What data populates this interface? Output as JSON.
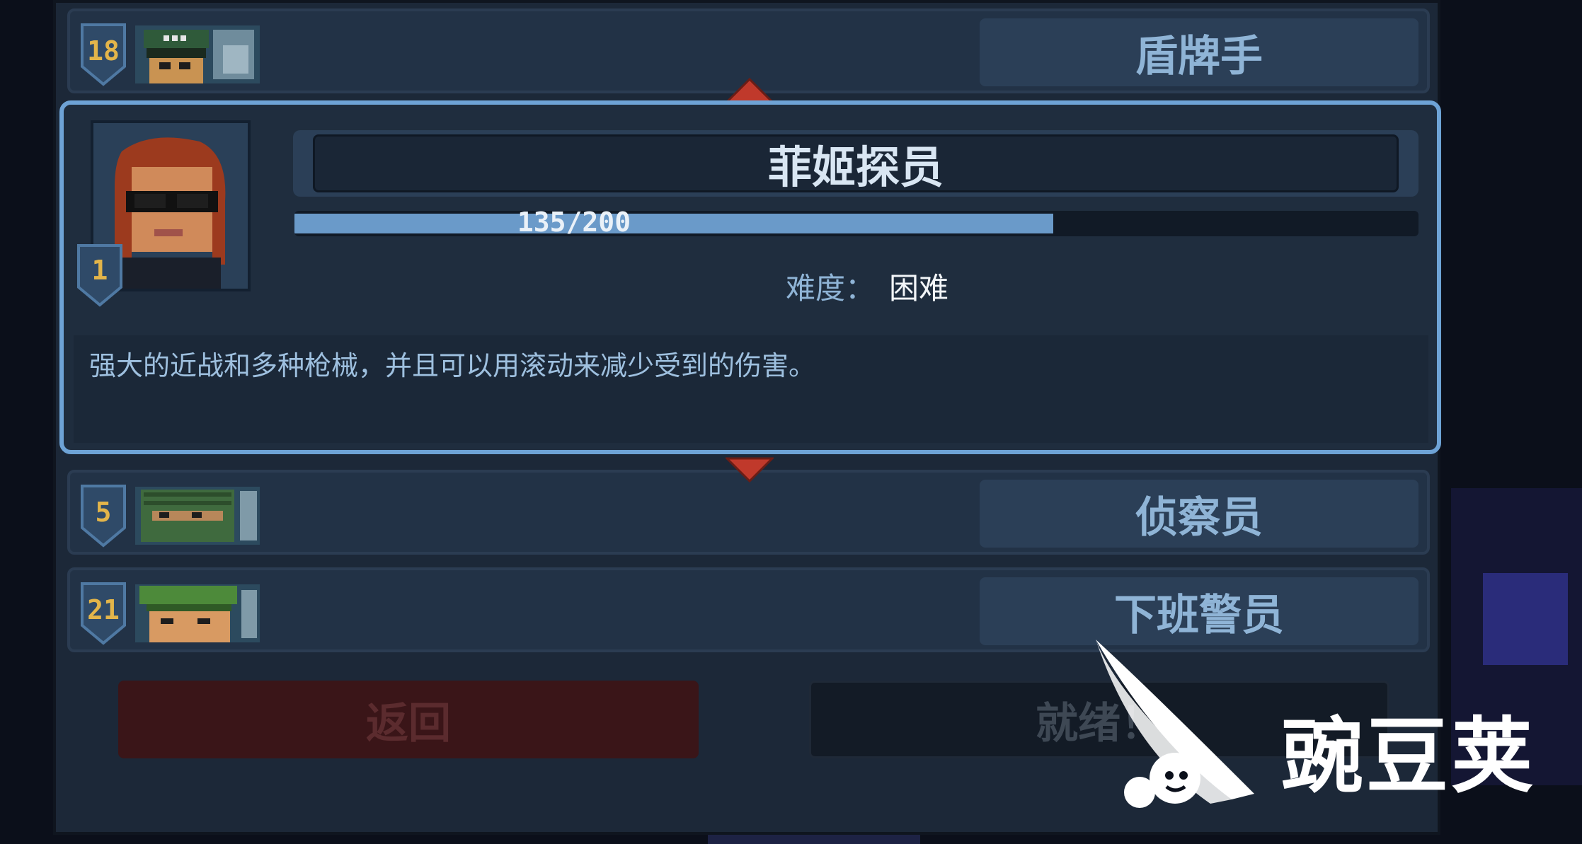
{
  "roster": [
    {
      "level": "18",
      "class_label": "盾牌手",
      "thumb": "soldier-helmet-portrait"
    },
    {
      "level": "5",
      "class_label": "侦察员",
      "thumb": "scout-portrait"
    },
    {
      "level": "21",
      "class_label": "下班警员",
      "thumb": "police-portrait"
    }
  ],
  "selected": {
    "name": "菲姬探员",
    "level": "1",
    "xp_text": "135/200",
    "xp_fraction": 0.675,
    "difficulty_label": "难度：",
    "difficulty_value": "困难",
    "description": "强大的近战和多种枪械，并且可以用滚动来减少受到的伤害。",
    "portrait": "agent-sunglasses-red-hair-portrait"
  },
  "buttons": {
    "back": "返回",
    "ready": "就绪！"
  },
  "watermark": {
    "text": "豌豆荚"
  },
  "colors": {
    "panel": "#1c2838",
    "accent_border": "#6ea3d6",
    "level_gold": "#e3b54a",
    "arrow_red": "#c0392b",
    "back_button": "#3a1518"
  }
}
